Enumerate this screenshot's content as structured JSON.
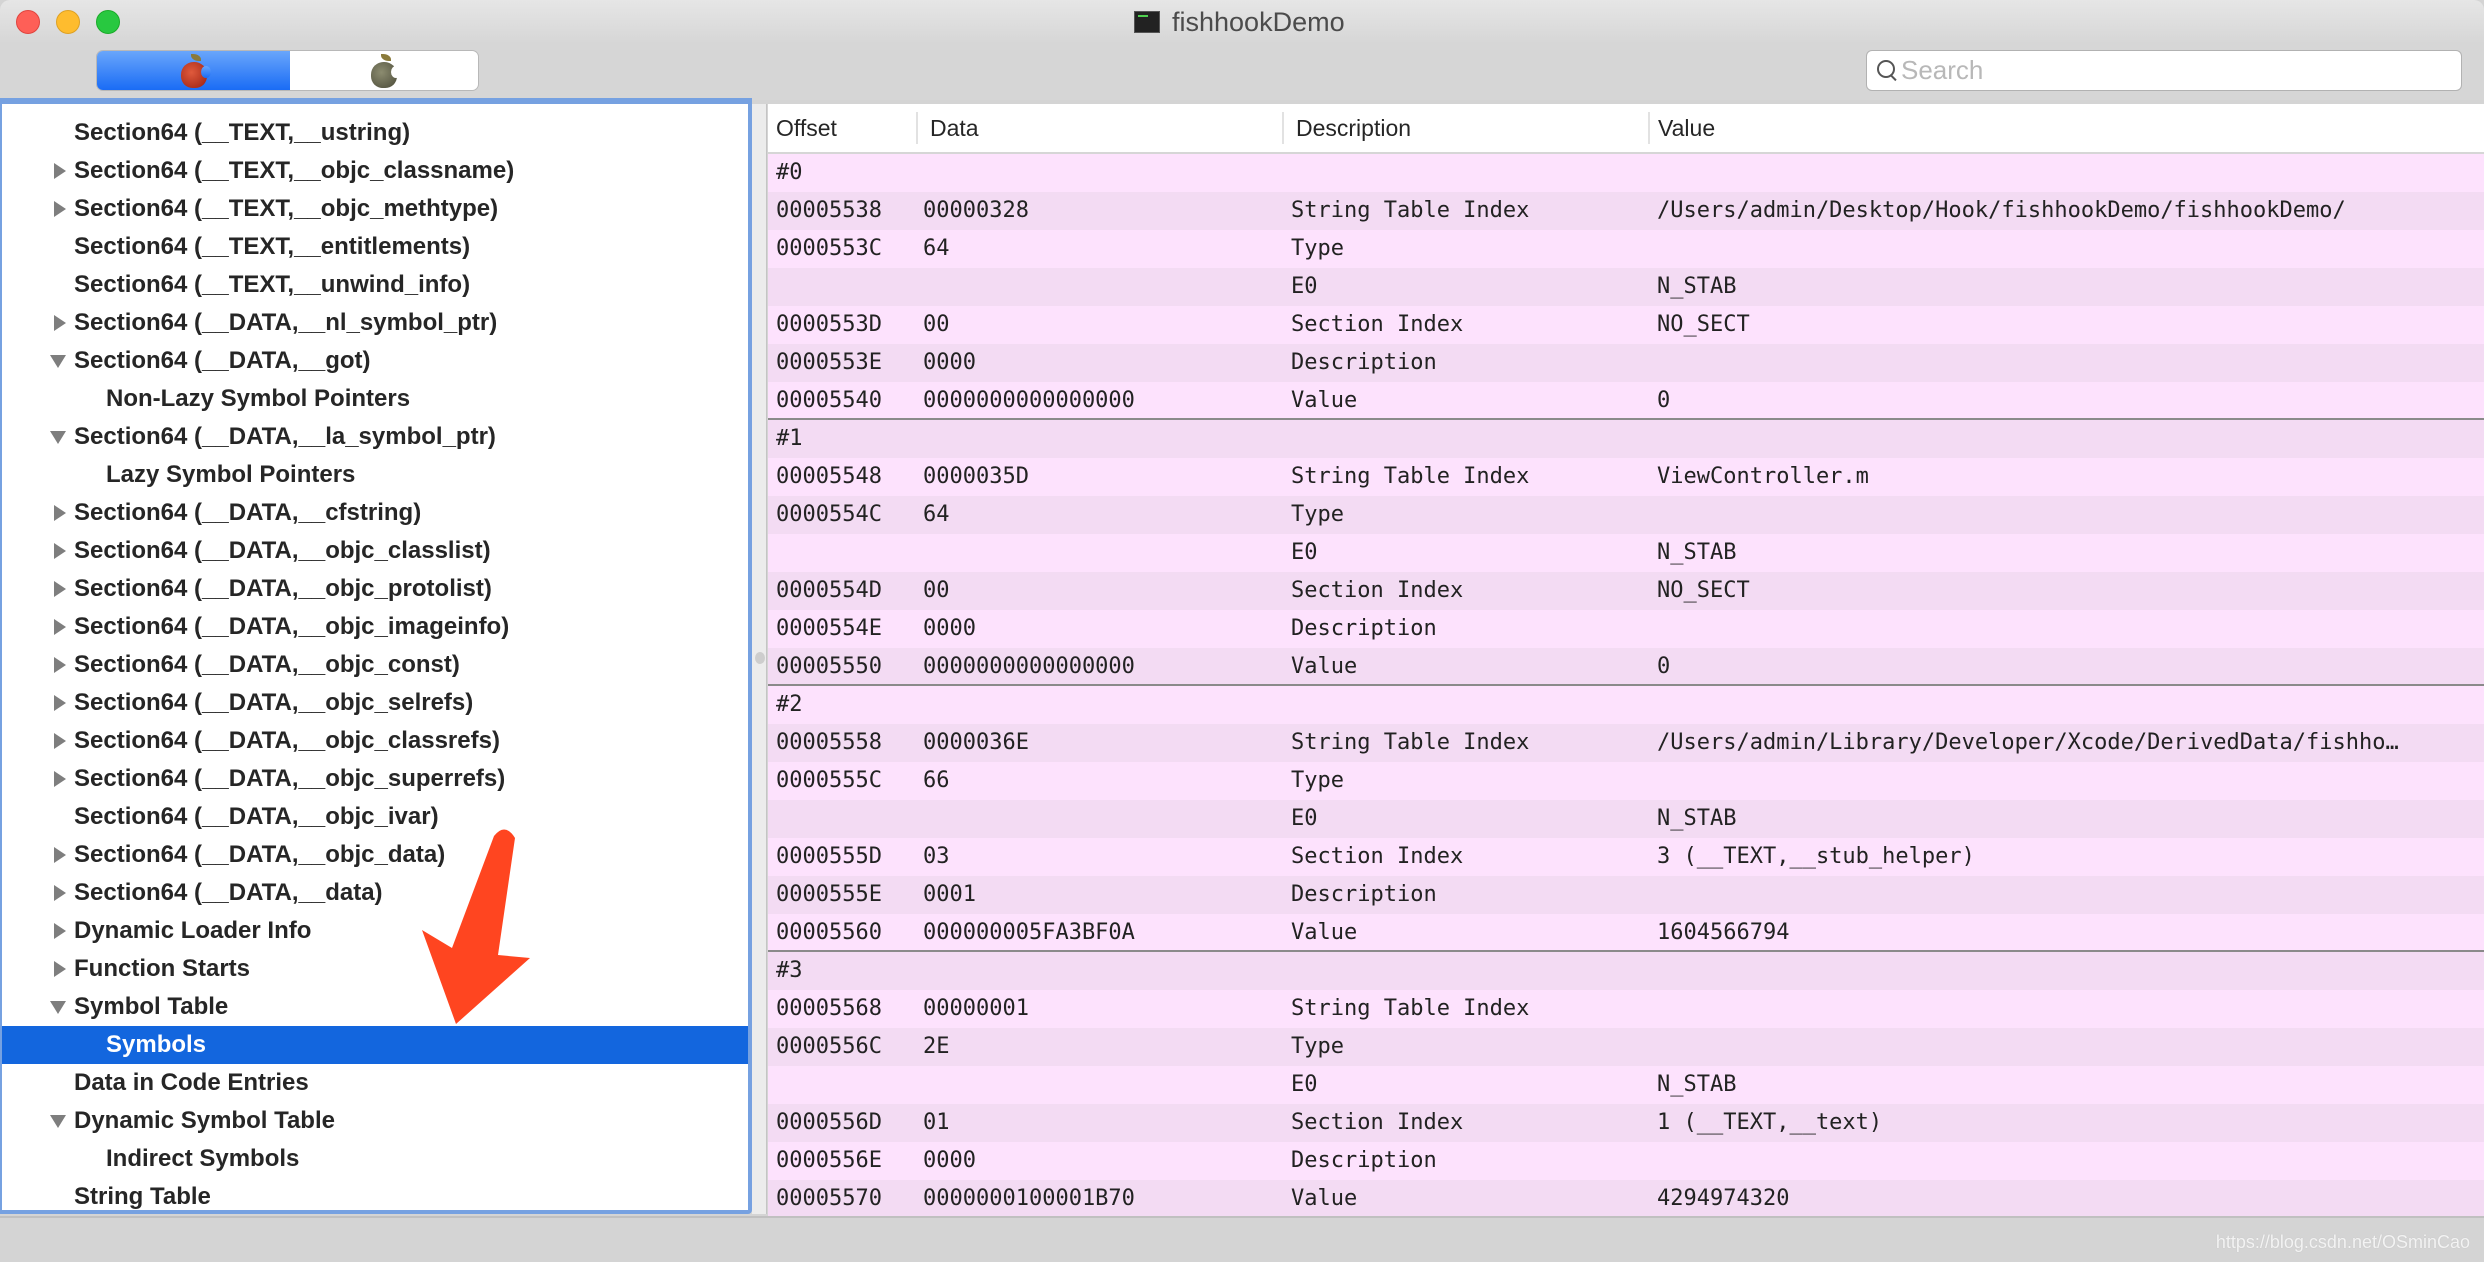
{
  "window": {
    "title": "fishhookDemo",
    "title_icon": "terminal-icon"
  },
  "toolbar": {
    "segments": [
      {
        "icon": "red-apple-icon",
        "selected": true
      },
      {
        "icon": "gray-apple-icon",
        "selected": false
      }
    ],
    "search": {
      "placeholder": "Search",
      "value": ""
    }
  },
  "sidebar": {
    "items": [
      {
        "label": "Section64 (__TEXT,__ustring)",
        "level": 0,
        "disclosure": "none"
      },
      {
        "label": "Section64 (__TEXT,__objc_classname)",
        "level": 0,
        "disclosure": "collapsed"
      },
      {
        "label": "Section64 (__TEXT,__objc_methtype)",
        "level": 0,
        "disclosure": "collapsed"
      },
      {
        "label": "Section64 (__TEXT,__entitlements)",
        "level": 0,
        "disclosure": "none"
      },
      {
        "label": "Section64 (__TEXT,__unwind_info)",
        "level": 0,
        "disclosure": "none"
      },
      {
        "label": "Section64 (__DATA,__nl_symbol_ptr)",
        "level": 0,
        "disclosure": "collapsed"
      },
      {
        "label": "Section64 (__DATA,__got)",
        "level": 0,
        "disclosure": "expanded"
      },
      {
        "label": "Non-Lazy Symbol Pointers",
        "level": 1,
        "disclosure": "none"
      },
      {
        "label": "Section64 (__DATA,__la_symbol_ptr)",
        "level": 0,
        "disclosure": "expanded"
      },
      {
        "label": "Lazy Symbol Pointers",
        "level": 1,
        "disclosure": "none"
      },
      {
        "label": "Section64 (__DATA,__cfstring)",
        "level": 0,
        "disclosure": "collapsed"
      },
      {
        "label": "Section64 (__DATA,__objc_classlist)",
        "level": 0,
        "disclosure": "collapsed"
      },
      {
        "label": "Section64 (__DATA,__objc_protolist)",
        "level": 0,
        "disclosure": "collapsed"
      },
      {
        "label": "Section64 (__DATA,__objc_imageinfo)",
        "level": 0,
        "disclosure": "collapsed"
      },
      {
        "label": "Section64 (__DATA,__objc_const)",
        "level": 0,
        "disclosure": "collapsed"
      },
      {
        "label": "Section64 (__DATA,__objc_selrefs)",
        "level": 0,
        "disclosure": "collapsed"
      },
      {
        "label": "Section64 (__DATA,__objc_classrefs)",
        "level": 0,
        "disclosure": "collapsed"
      },
      {
        "label": "Section64 (__DATA,__objc_superrefs)",
        "level": 0,
        "disclosure": "collapsed"
      },
      {
        "label": "Section64 (__DATA,__objc_ivar)",
        "level": 0,
        "disclosure": "none"
      },
      {
        "label": "Section64 (__DATA,__objc_data)",
        "level": 0,
        "disclosure": "collapsed"
      },
      {
        "label": "Section64 (__DATA,__data)",
        "level": 0,
        "disclosure": "collapsed"
      },
      {
        "label": "Dynamic Loader Info",
        "level": 0,
        "disclosure": "collapsed"
      },
      {
        "label": "Function Starts",
        "level": 0,
        "disclosure": "collapsed"
      },
      {
        "label": "Symbol Table",
        "level": 0,
        "disclosure": "expanded"
      },
      {
        "label": "Symbols",
        "level": 1,
        "disclosure": "none",
        "selected": true
      },
      {
        "label": "Data in Code Entries",
        "level": 0,
        "disclosure": "none"
      },
      {
        "label": "Dynamic Symbol Table",
        "level": 0,
        "disclosure": "expanded"
      },
      {
        "label": "Indirect Symbols",
        "level": 1,
        "disclosure": "none"
      },
      {
        "label": "String Table",
        "level": 0,
        "disclosure": "none"
      }
    ]
  },
  "table": {
    "columns": [
      "Offset",
      "Data",
      "Description",
      "Value"
    ],
    "rows": [
      {
        "cells": [
          "#0",
          "",
          "",
          ""
        ],
        "group_header": true
      },
      {
        "cells": [
          "00005538",
          "00000328",
          "String Table Index",
          "/Users/admin/Desktop/Hook/fishhookDemo/fishhookDemo/"
        ]
      },
      {
        "cells": [
          "0000553C",
          "64",
          "Type",
          ""
        ]
      },
      {
        "cells": [
          "",
          "",
          "E0",
          "N_STAB"
        ]
      },
      {
        "cells": [
          "0000553D",
          "00",
          "Section Index",
          "NO_SECT"
        ]
      },
      {
        "cells": [
          "0000553E",
          "0000",
          "Description",
          ""
        ]
      },
      {
        "cells": [
          "00005540",
          "0000000000000000",
          "Value",
          "0"
        ],
        "group_end": true
      },
      {
        "cells": [
          "#1",
          "",
          "",
          ""
        ],
        "group_header": true
      },
      {
        "cells": [
          "00005548",
          "0000035D",
          "String Table Index",
          "ViewController.m"
        ]
      },
      {
        "cells": [
          "0000554C",
          "64",
          "Type",
          ""
        ]
      },
      {
        "cells": [
          "",
          "",
          "E0",
          "N_STAB"
        ]
      },
      {
        "cells": [
          "0000554D",
          "00",
          "Section Index",
          "NO_SECT"
        ]
      },
      {
        "cells": [
          "0000554E",
          "0000",
          "Description",
          ""
        ]
      },
      {
        "cells": [
          "00005550",
          "0000000000000000",
          "Value",
          "0"
        ],
        "group_end": true
      },
      {
        "cells": [
          "#2",
          "",
          "",
          ""
        ],
        "group_header": true
      },
      {
        "cells": [
          "00005558",
          "0000036E",
          "String Table Index",
          "/Users/admin/Library/Developer/Xcode/DerivedData/fishho…"
        ]
      },
      {
        "cells": [
          "0000555C",
          "66",
          "Type",
          ""
        ]
      },
      {
        "cells": [
          "",
          "",
          "E0",
          "N_STAB"
        ]
      },
      {
        "cells": [
          "0000555D",
          "03",
          "Section Index",
          "3 (__TEXT,__stub_helper)"
        ]
      },
      {
        "cells": [
          "0000555E",
          "0001",
          "Description",
          ""
        ]
      },
      {
        "cells": [
          "00005560",
          "000000005FA3BF0A",
          "Value",
          "1604566794"
        ],
        "group_end": true
      },
      {
        "cells": [
          "#3",
          "",
          "",
          ""
        ],
        "group_header": true
      },
      {
        "cells": [
          "00005568",
          "00000001",
          "String Table Index",
          ""
        ]
      },
      {
        "cells": [
          "0000556C",
          "2E",
          "Type",
          ""
        ]
      },
      {
        "cells": [
          "",
          "",
          "E0",
          "N_STAB"
        ]
      },
      {
        "cells": [
          "0000556D",
          "01",
          "Section Index",
          "1 (__TEXT,__text)"
        ]
      },
      {
        "cells": [
          "0000556E",
          "0000",
          "Description",
          ""
        ]
      },
      {
        "cells": [
          "00005570",
          "0000000100001B70",
          "Value",
          "4294974320"
        ]
      }
    ]
  },
  "annotation": {
    "type": "arrow",
    "color": "#ff4520",
    "points_to": "Symbols"
  },
  "colors": {
    "selection": "#1366de",
    "row_light": "#fde2fd",
    "row_dark": "#f3dbf3",
    "focus_ring": "#76a1e1"
  },
  "watermark": "https://blog.csdn.net/OSminCao"
}
